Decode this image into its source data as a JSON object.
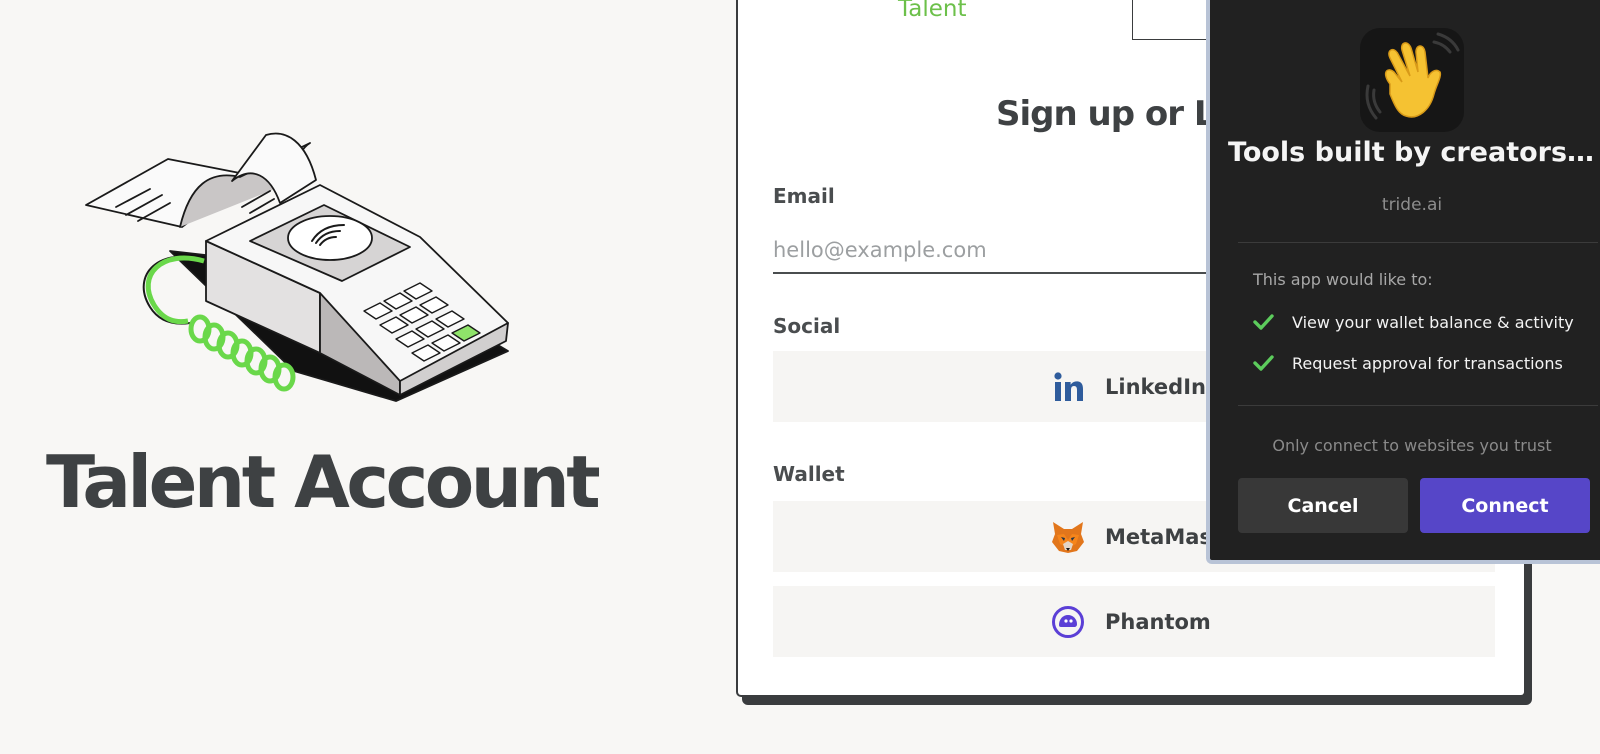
{
  "hero": {
    "title": "Talent Account"
  },
  "auth": {
    "brand_name": "Talent",
    "heading": "Sign up or Lo",
    "email_label": "Email",
    "email_value": "",
    "email_placeholder": "hello@example.com",
    "social_label": "Social",
    "wallet_label": "Wallet",
    "providers": {
      "linkedin": {
        "label": "LinkedIn",
        "icon": "linkedin-icon"
      },
      "metamask": {
        "label": "MetaMasl",
        "icon": "metamask-fox-icon"
      },
      "phantom": {
        "label": "Phantom",
        "icon": "phantom-ghost-icon"
      }
    }
  },
  "popup": {
    "title": "Tools built by creators, f...",
    "domain": "tride.ai",
    "app_icon": "waving-hand-icon",
    "perm_heading": "This app would like to:",
    "permissions": [
      "View your wallet balance & activity",
      "Request approval for transactions"
    ],
    "trust_note": "Only connect to websites you trust",
    "cancel_label": "Cancel",
    "connect_label": "Connect"
  },
  "colors": {
    "page_bg": "#f8f7f5",
    "brand_green": "#6cc04a",
    "text_dark": "#3e4143",
    "popup_bg": "#212121",
    "connect_purple": "#5646c8",
    "check_green": "#5ccc5c",
    "linkedin_blue": "#2f5c9c",
    "phantom_purple": "#5b3fd6"
  }
}
